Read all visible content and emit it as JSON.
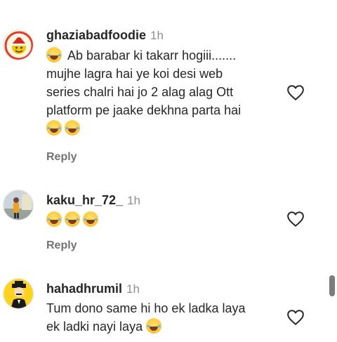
{
  "comments": [
    {
      "username": "ghaziabadfoodie",
      "time": "1h",
      "lines": [
        "Ab barabar ki takarr hogiii.......",
        "mujhe lagra hai ye koi desi web",
        "series chalri hai jo 2 alag alag Ott",
        "platform pe jaake dekhna parta hai"
      ],
      "reply_label": "Reply",
      "avatar_icon": "logo-avatar",
      "heart_icon": "heart-outline-icon"
    },
    {
      "username": "kaku_hr_72_",
      "time": "1h",
      "lines": [],
      "reply_label": "Reply",
      "avatar_icon": "photo-avatar",
      "heart_icon": "heart-outline-icon"
    },
    {
      "username": "hahadhrumil",
      "time": "1h",
      "lines": [
        "Tum dono same hi ho ek ladka laya",
        "ek ladki nayi laya"
      ],
      "avatar_icon": "cartoon-avatar",
      "heart_icon": "heart-outline-icon"
    }
  ],
  "emoji_name": "face-with-tears-of-joy"
}
